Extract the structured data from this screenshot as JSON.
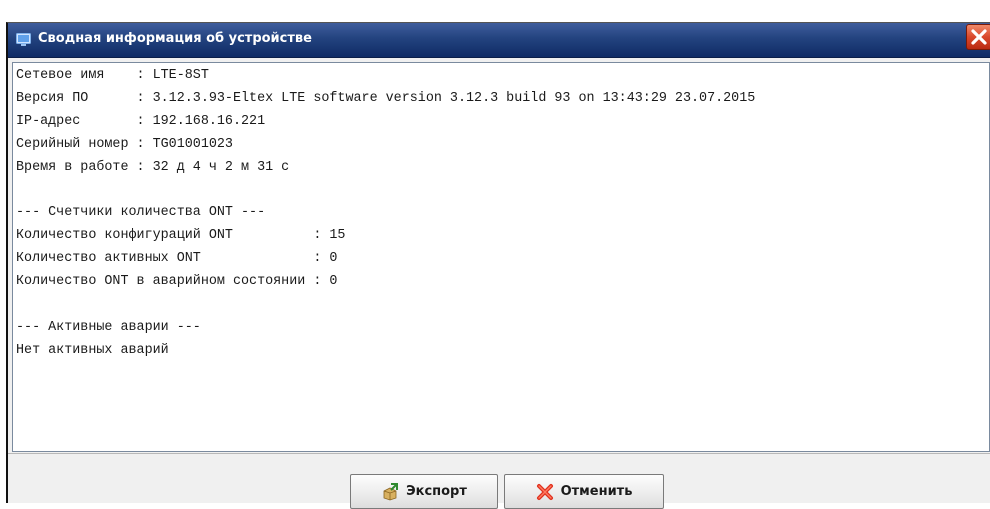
{
  "window": {
    "title": "Сводная информация об устройстве",
    "icon": "monitor-icon",
    "close_icon": "close-x-icon"
  },
  "content": {
    "lines": [
      "Сетевое имя    : LTE-8ST",
      "Версия ПО      : 3.12.3.93-Eltex LTE software version 3.12.3 build 93 on 13:43:29 23.07.2015",
      "IP-адрес       : 192.168.16.221",
      "Серийный номер : TG01001023",
      "Время в работе : 32 д 4 ч 2 м 31 с",
      "",
      "--- Счетчики количества ONT ---",
      "Количество конфигураций ONT          : 15",
      "Количество активных ONT              : 0",
      "Количество ONT в аварийном состоянии : 0",
      "",
      "--- Активные аварии ---",
      "Нет активных аварий"
    ]
  },
  "buttons": {
    "export_label": "Экспорт",
    "export_icon": "box-export-icon",
    "cancel_label": "Отменить",
    "cancel_icon": "red-x-icon"
  },
  "colors": {
    "titlebar": "#23437f",
    "close_button": "#d9482b"
  }
}
